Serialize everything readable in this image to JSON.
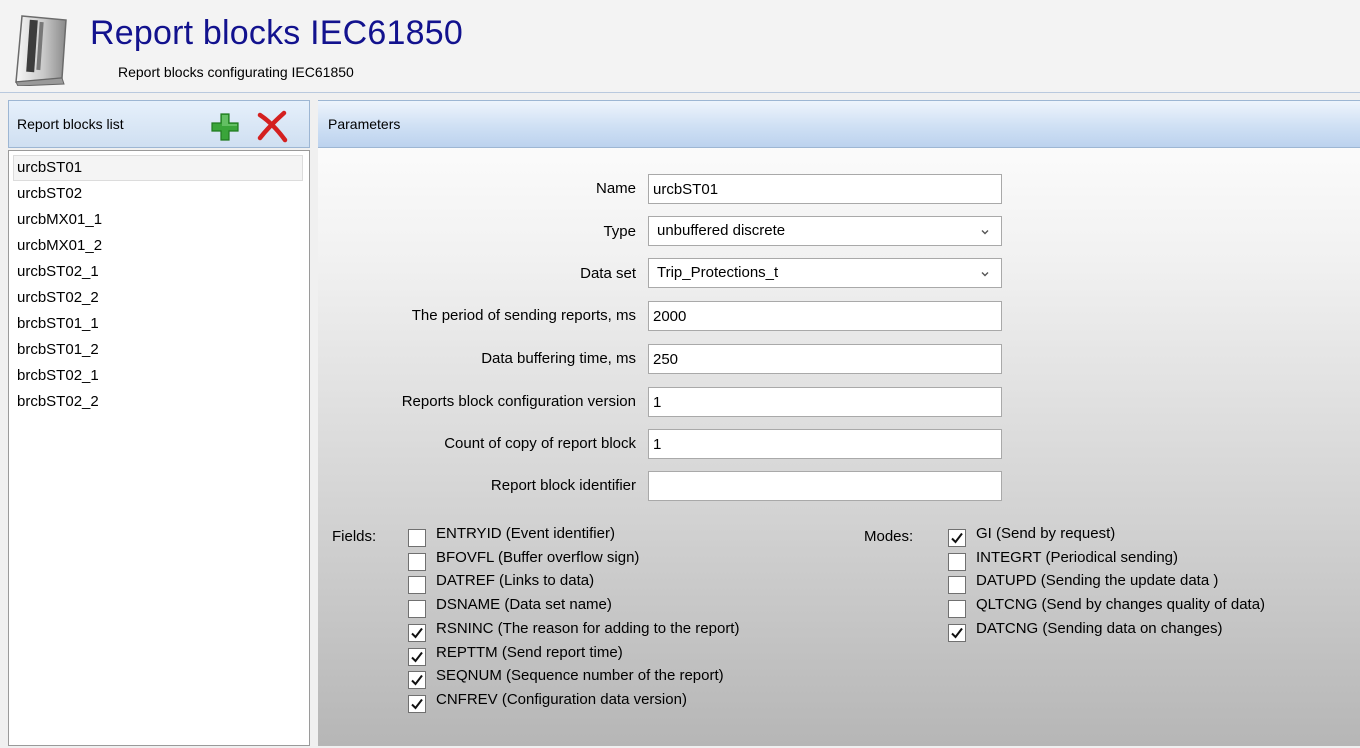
{
  "header": {
    "title": "Report blocks IEC61850",
    "subtitle": "Report blocks configurating IEC61850",
    "icon": "report-book-icon"
  },
  "sidebar": {
    "title": "Report blocks list",
    "add_icon": "add-icon",
    "delete_icon": "delete-icon",
    "selected_index": 0,
    "items": [
      {
        "label": "urcbST01"
      },
      {
        "label": "urcbST02"
      },
      {
        "label": "urcbMX01_1"
      },
      {
        "label": "urcbMX01_2"
      },
      {
        "label": "urcbST02_1"
      },
      {
        "label": "urcbST02_2"
      },
      {
        "label": "brcbST01_1"
      },
      {
        "label": "brcbST01_2"
      },
      {
        "label": "brcbST02_1"
      },
      {
        "label": "brcbST02_2"
      }
    ]
  },
  "parameters": {
    "title": "Parameters",
    "name": {
      "label": "Name",
      "value": "urcbST01"
    },
    "type": {
      "label": "Type",
      "value": "unbuffered discrete"
    },
    "data_set": {
      "label": "Data set",
      "value": "Trip_Protections_t"
    },
    "period": {
      "label": "The period of sending reports, ms",
      "value": "2000"
    },
    "buffering_time": {
      "label": "Data buffering time, ms",
      "value": "250"
    },
    "config_version": {
      "label": "Reports block configuration version",
      "value": "1"
    },
    "copy_count": {
      "label": "Count of copy of report block",
      "value": "1"
    },
    "identifier": {
      "label": "Report block identifier",
      "value": ""
    }
  },
  "fields": {
    "label": "Fields:",
    "items": [
      {
        "label": "ENTRYID (Event identifier)",
        "checked": false
      },
      {
        "label": "BFOVFL (Buffer overflow sign)",
        "checked": false
      },
      {
        "label": "DATREF (Links to data)",
        "checked": false
      },
      {
        "label": "DSNAME (Data set name)",
        "checked": false
      },
      {
        "label": "RSNINC (The reason for adding to the report)",
        "checked": true
      },
      {
        "label": "REPTTM (Send report time)",
        "checked": true
      },
      {
        "label": "SEQNUM (Sequence number of the report)",
        "checked": true
      },
      {
        "label": "CNFREV (Configuration data version)",
        "checked": true
      }
    ]
  },
  "modes": {
    "label": "Modes:",
    "items": [
      {
        "label": "GI (Send by request)",
        "checked": true
      },
      {
        "label": "INTEGRT (Periodical sending)",
        "checked": false
      },
      {
        "label": "DATUPD (Sending the update data )",
        "checked": false
      },
      {
        "label": "QLTCNG (Send by changes quality of data)",
        "checked": false
      },
      {
        "label": "DATCNG (Sending data on changes)",
        "checked": true
      }
    ]
  },
  "colors": {
    "title": "#12128e",
    "header_gradient_top": "#e6f0fb",
    "header_gradient_bottom": "#cfdff1",
    "add_green": "#3aa53a",
    "delete_red": "#d42020"
  }
}
